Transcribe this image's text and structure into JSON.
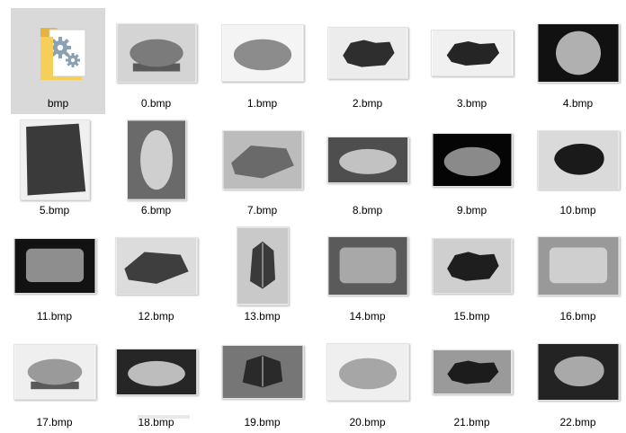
{
  "folder": {
    "name": "bmp",
    "icon": "folder-gears-icon",
    "selected": true
  },
  "files": [
    {
      "name": "0.bmp",
      "w": 90,
      "h": 66,
      "bg": "#d4d4d4",
      "shape": "plinth",
      "fg": "#7b7b7b"
    },
    {
      "name": "1.bmp",
      "w": 92,
      "h": 64,
      "bg": "#f4f4f4",
      "shape": "oval",
      "fg": "#8c8c8c"
    },
    {
      "name": "2.bmp",
      "w": 90,
      "h": 58,
      "bg": "#ececec",
      "shape": "jagged",
      "fg": "#2e2e2e"
    },
    {
      "name": "3.bmp",
      "w": 92,
      "h": 52,
      "bg": "#f0f0f0",
      "shape": "jagged",
      "fg": "#252525"
    },
    {
      "name": "4.bmp",
      "w": 92,
      "h": 66,
      "bg": "#111111",
      "shape": "tall",
      "fg": "#b0b0b0"
    },
    {
      "name": "5.bmp",
      "w": 78,
      "h": 90,
      "bg": "#f0f0f0",
      "shape": "slab",
      "fg": "#3a3a3a"
    },
    {
      "name": "6.bmp",
      "w": 66,
      "h": 90,
      "bg": "#6a6a6a",
      "shape": "tall",
      "fg": "#cfcfcf"
    },
    {
      "name": "7.bmp",
      "w": 90,
      "h": 66,
      "bg": "#bcbcbc",
      "shape": "wedge",
      "fg": "#6a6a6a"
    },
    {
      "name": "8.bmp",
      "w": 92,
      "h": 52,
      "bg": "#4e4e4e",
      "shape": "oval",
      "fg": "#c2c2c2"
    },
    {
      "name": "9.bmp",
      "w": 90,
      "h": 60,
      "bg": "#050505",
      "shape": "oval",
      "fg": "#8a8a8a"
    },
    {
      "name": "10.bmp",
      "w": 92,
      "h": 66,
      "bg": "#dadada",
      "shape": "blob",
      "fg": "#1a1a1a"
    },
    {
      "name": "11.bmp",
      "w": 92,
      "h": 62,
      "bg": "#121212",
      "shape": "block",
      "fg": "#8e8e8e"
    },
    {
      "name": "12.bmp",
      "w": 92,
      "h": 64,
      "bg": "#dcdcdc",
      "shape": "wedge",
      "fg": "#3e3e3e"
    },
    {
      "name": "13.bmp",
      "w": 58,
      "h": 88,
      "bg": "#c9c9c9",
      "shape": "crystal",
      "fg": "#3a3a3a"
    },
    {
      "name": "14.bmp",
      "w": 90,
      "h": 66,
      "bg": "#5a5a5a",
      "shape": "block",
      "fg": "#a8a8a8"
    },
    {
      "name": "15.bmp",
      "w": 90,
      "h": 62,
      "bg": "#cfcfcf",
      "shape": "jagged",
      "fg": "#1e1e1e"
    },
    {
      "name": "16.bmp",
      "w": 92,
      "h": 66,
      "bg": "#999999",
      "shape": "block",
      "fg": "#cfcfcf"
    },
    {
      "name": "17.bmp",
      "w": 92,
      "h": 62,
      "bg": "#efefef",
      "shape": "plinth",
      "fg": "#9a9a9a"
    },
    {
      "name": "18.bmp",
      "w": 92,
      "h": 52,
      "bg": "#262626",
      "shape": "oval",
      "fg": "#bdbdbd"
    },
    {
      "name": "19.bmp",
      "w": 92,
      "h": 60,
      "bg": "#767676",
      "shape": "crystal",
      "fg": "#2a2a2a"
    },
    {
      "name": "20.bmp",
      "w": 92,
      "h": 64,
      "bg": "#efefef",
      "shape": "oval",
      "fg": "#a6a6a6"
    },
    {
      "name": "21.bmp",
      "w": 90,
      "h": 50,
      "bg": "#9a9a9a",
      "shape": "jagged",
      "fg": "#1c1c1c"
    },
    {
      "name": "22.bmp",
      "w": 92,
      "h": 64,
      "bg": "#232323",
      "shape": "blob",
      "fg": "#a9a9a9"
    }
  ],
  "colors": {
    "folder_yellow": "#f6cf5b",
    "folder_yellow_dark": "#e6b43a",
    "selection": "#d9d9d9",
    "text": "#000000"
  }
}
